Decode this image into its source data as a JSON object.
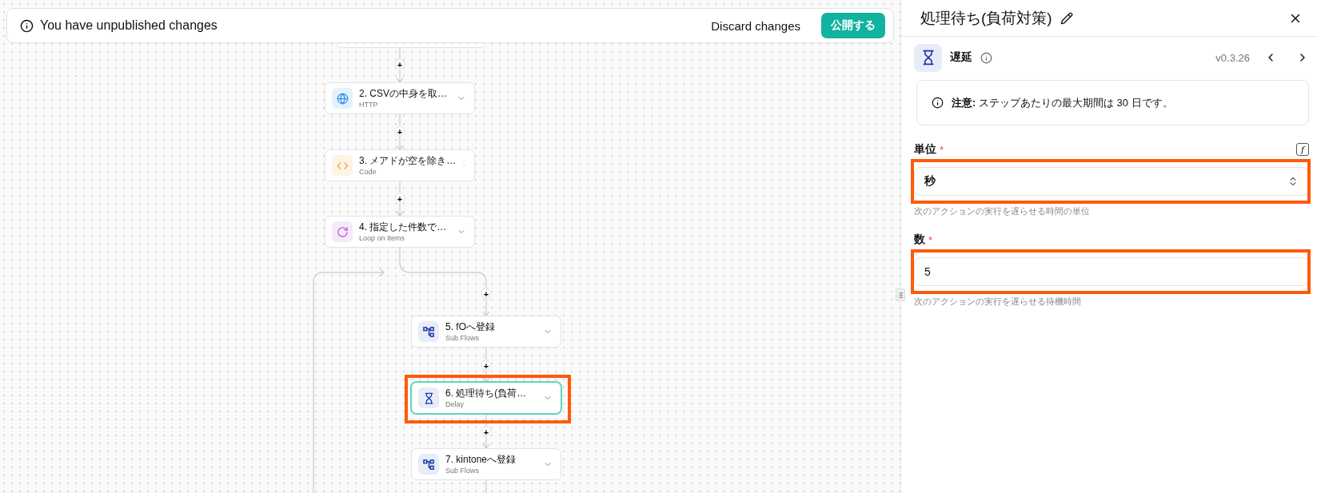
{
  "banner": {
    "message": "You have unpublished changes",
    "discard": "Discard changes",
    "publish": "公開する"
  },
  "flow": {
    "nodes": [
      {
        "kind": "stub"
      },
      {
        "kind": "http",
        "title": "2. CSVの中身を取…",
        "subtitle": "HTTP",
        "selected": false,
        "highlighted": false
      },
      {
        "kind": "code",
        "title": "3. メアドが空を除き…",
        "subtitle": "Code",
        "selected": false,
        "highlighted": false
      },
      {
        "kind": "loop",
        "title": "4. 指定した件数で…",
        "subtitle": "Loop on Items",
        "selected": false,
        "highlighted": false
      },
      {
        "kind": "subflow",
        "title": "5. fOへ登録",
        "subtitle": "Sub Flows",
        "selected": false,
        "highlighted": false
      },
      {
        "kind": "delay",
        "title": "6. 処理待ち(負荷…",
        "subtitle": "Delay",
        "selected": true,
        "highlighted": true
      },
      {
        "kind": "subflow",
        "title": "7. kintoneへ登録",
        "subtitle": "Sub Flows",
        "selected": false,
        "highlighted": false
      }
    ],
    "add_buttons": [
      "+",
      "+",
      "+",
      "+",
      "+",
      "+"
    ]
  },
  "panel": {
    "title": "処理待ち(負荷対策)",
    "step": {
      "kind": "delay",
      "name": "遅延",
      "version": "v0.3.26"
    },
    "notice": "**注意:** ステップあたりの最大期間は 30 日です。",
    "fields": [
      {
        "kind": "select",
        "label": "単位",
        "required_mark": "*",
        "formula_icon": "f",
        "value": "秒",
        "helper": "次のアクションの実行を遅らせる時間の単位",
        "highlighted": true
      },
      {
        "kind": "number",
        "label": "数",
        "required_mark": "*",
        "value": "5",
        "helper": "次のアクションの実行を遅らせる待機時間",
        "highlighted": true
      }
    ]
  }
}
